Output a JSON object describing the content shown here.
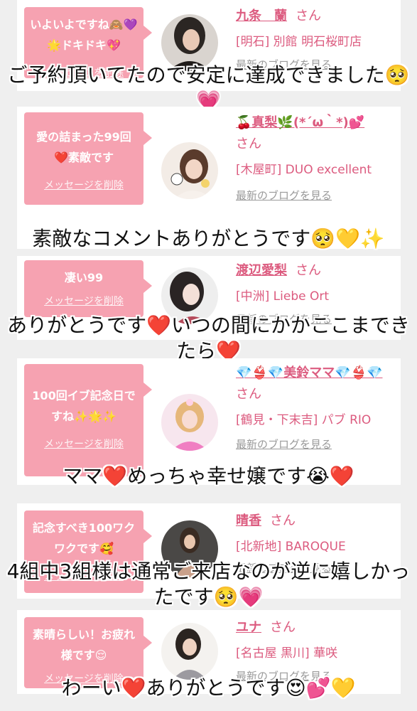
{
  "colors": {
    "accent_pink": "#dc5b7f",
    "bubble_pink": "#f6a2b1",
    "background": "#efefef",
    "link_gray": "#9a9a9a"
  },
  "entries": [
    {
      "message": "いよいよですね🙈💜🌟ドキドキ💖",
      "delete_label": "メッセージを削除",
      "name": "九条　蘭",
      "san": "さん",
      "shop": "[明石] 別館 明石桜町店",
      "blog_label": "最新のブログを見る",
      "caption": "ご予約頂いてたので安定に達成できました🥺💗",
      "avatar_icon": "woman-portrait-icon"
    },
    {
      "message": "愛の詰まった99回❤️素敵です",
      "delete_label": "メッセージを削除",
      "name": "🍒真梨🌿(*´ω｀*)💕",
      "san": "さん",
      "shop": "[木屋町] DUO excellent",
      "blog_label": "最新のブログを見る",
      "caption": "素敵なコメントありがとうです🥺💛✨",
      "avatar_icon": "woman-portrait-icon"
    },
    {
      "message": "凄い99",
      "delete_label": "メッセージを削除",
      "name": "渡辺愛梨",
      "san": "さん",
      "shop": "[中洲] Liebe Ort",
      "blog_label": "最新のブログを見る",
      "caption": "ありがとうです❤️いつの間にかかここまできたら❤️",
      "avatar_icon": "woman-portrait-icon"
    },
    {
      "message": "100回イブ記念日ですね✨🌟✨",
      "delete_label": "メッセージを削除",
      "name": "💎👙💎美鈴ママ💎👙💎",
      "san": "さん",
      "shop": "[鶴見・下末吉] パブ RIO",
      "blog_label": "最新のブログを見る",
      "caption": "ママ❤️めっちゃ幸せ嬢です😭❤️",
      "avatar_icon": "woman-portrait-icon"
    },
    {
      "message": "記念すべき100ワクワクです🥰",
      "delete_label": "メッセージを削除",
      "name": "晴香",
      "san": "さん",
      "shop": "[北新地] BAROQUE",
      "blog_label": "最新のブログを見る",
      "caption": "4組中3組様は通常ご来店なのが逆に嬉しかったです🥺💗",
      "avatar_icon": "woman-portrait-icon"
    },
    {
      "message": "素晴らしい！お疲れ様です😌",
      "delete_label": "メッセージを削除",
      "name": "ユナ",
      "san": "さん",
      "shop": "[名古屋 黒川] 華咲",
      "blog_label": "最新のブログを見る",
      "caption": "わーい❤️ありがとうです😍💕💛",
      "avatar_icon": "woman-portrait-icon"
    }
  ]
}
